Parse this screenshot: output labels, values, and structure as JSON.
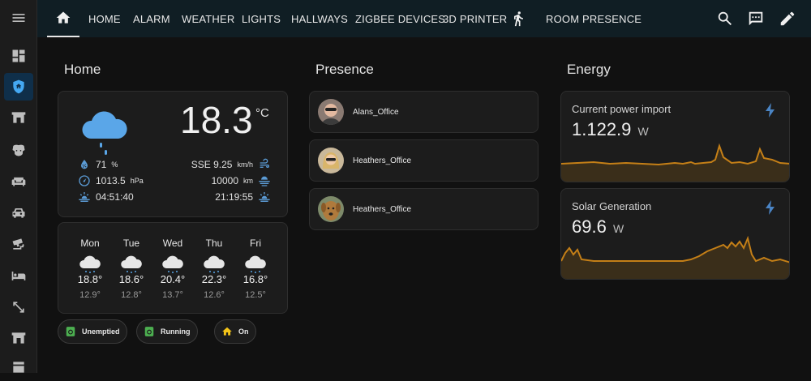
{
  "nav": {
    "tabs": [
      "HOME",
      "ALARM",
      "WEATHER",
      "LIGHTS",
      "HALLWAYS",
      "ZIGBEE DEVICES",
      "3D PRINTER",
      "ROOM PRESENCE"
    ]
  },
  "home": {
    "title": "Home",
    "weather": {
      "temperature": "18.3",
      "unit": "°C",
      "humidity": "71",
      "humidity_unit": "%",
      "pressure": "1013.5",
      "pressure_unit": "hPa",
      "sunrise": "04:51:40",
      "wind": "SSE 9.25",
      "wind_unit": "km/h",
      "visibility": "10000",
      "visibility_unit": "km",
      "sunset": "21:19:55"
    },
    "forecast": [
      {
        "day": "Mon",
        "high": "18.8°",
        "low": "12.9°"
      },
      {
        "day": "Tue",
        "high": "18.6°",
        "low": "12.8°"
      },
      {
        "day": "Wed",
        "high": "20.4°",
        "low": "13.7°"
      },
      {
        "day": "Thu",
        "high": "22.3°",
        "low": "12.6°"
      },
      {
        "day": "Fri",
        "high": "16.8°",
        "low": "12.5°"
      }
    ],
    "chips": [
      "Unemptied",
      "Running",
      "On"
    ]
  },
  "presence": {
    "title": "Presence",
    "people": [
      "Alans_Office",
      "Heathers_Office",
      "Heathers_Office"
    ]
  },
  "energy": {
    "title": "Energy",
    "import": {
      "label": "Current power import",
      "value": "1.122.9",
      "unit": "W"
    },
    "solar": {
      "label": "Solar Generation",
      "value": "69.6",
      "unit": "W"
    }
  },
  "colors": {
    "accent": "#44a8f2",
    "spark": "#c47f17",
    "bolt": "#4a84c4",
    "chip_green": "#4caf50",
    "chip_yellow": "#f5c518"
  }
}
